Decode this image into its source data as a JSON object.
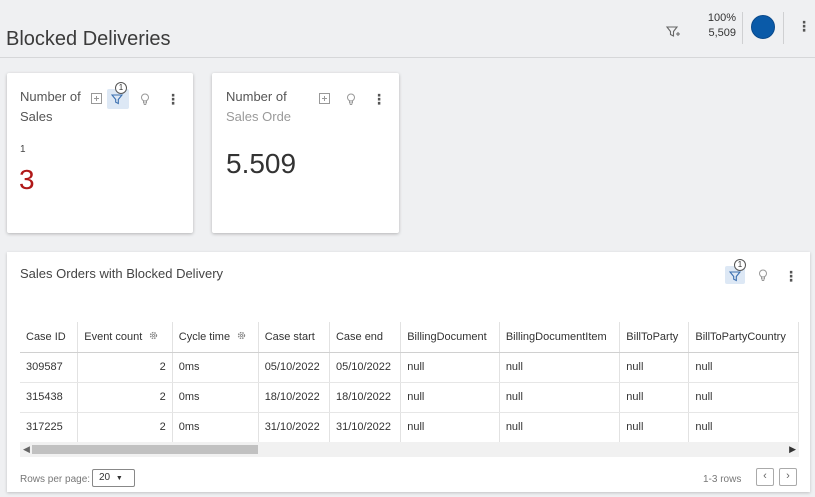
{
  "page": {
    "title": "Blocked Deliveries"
  },
  "header": {
    "percent": "100%",
    "count": "5,509"
  },
  "card1": {
    "title": "Number of Sales",
    "filter_badge": "1",
    "sub_value": "1",
    "value": "3",
    "value_color": "#b01818"
  },
  "card2": {
    "title_line1": "Number of",
    "title_line2": "Sales Orde",
    "value": "5.509"
  },
  "panel": {
    "title": "Sales Orders with Blocked Delivery",
    "filter_badge": "1",
    "columns": [
      "Case ID",
      "Event count",
      "Cycle time",
      "Case start",
      "Case end",
      "BillingDocument",
      "BillingDocumentItem",
      "BillToParty",
      "BillToPartyCountry"
    ],
    "rows": [
      [
        "309587",
        "2",
        "0ms",
        "05/10/2022",
        "05/10/2022",
        "null",
        "null",
        "null",
        "null"
      ],
      [
        "315438",
        "2",
        "0ms",
        "18/10/2022",
        "18/10/2022",
        "null",
        "null",
        "null",
        "null"
      ],
      [
        "317225",
        "2",
        "0ms",
        "31/10/2022",
        "31/10/2022",
        "null",
        "null",
        "null",
        "null"
      ]
    ],
    "rows_per_page_label": "Rows per page:",
    "rows_per_page_value": "20",
    "rows_count": "1-3 rows",
    "prev_icon": "‹",
    "next_icon": "›"
  },
  "colors": {
    "accent": "#0a5aa8",
    "alert": "#b01818",
    "background": "#eff0f2"
  }
}
